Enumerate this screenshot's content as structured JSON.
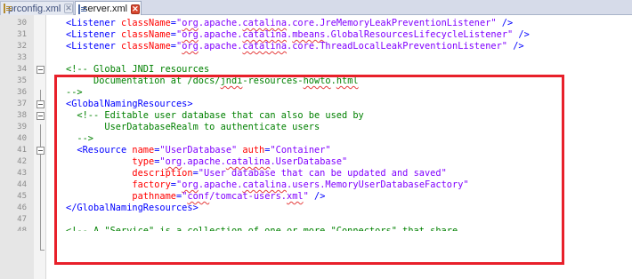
{
  "tabs": [
    {
      "label": "prconfig.xml",
      "close": "✕",
      "active": false
    },
    {
      "label": "server.xml",
      "close": "✕",
      "active": true
    }
  ],
  "editor": {
    "colors": {
      "tag": "#0000ff",
      "attr": "#ff0000",
      "value": "#8000ff",
      "comment": "#008000",
      "highlight": "#e8202a"
    },
    "lines": [
      {
        "n": "30",
        "tokens": [
          {
            "c": "t",
            "t": "<Listener "
          },
          {
            "c": "a",
            "t": "className"
          },
          {
            "c": "t",
            "t": "="
          },
          {
            "c": "v",
            "t": "\""
          },
          {
            "c": "vs",
            "t": "org"
          },
          {
            "c": "v",
            "t": ".apache."
          },
          {
            "c": "vs",
            "t": "catalina"
          },
          {
            "c": "v",
            "t": ".core.JreMemoryLeakPreventionListener\""
          },
          {
            "c": "t",
            "t": " />"
          }
        ]
      },
      {
        "n": "31",
        "tokens": [
          {
            "c": "t",
            "t": "<Listener "
          },
          {
            "c": "a",
            "t": "className"
          },
          {
            "c": "t",
            "t": "="
          },
          {
            "c": "v",
            "t": "\""
          },
          {
            "c": "vs",
            "t": "org"
          },
          {
            "c": "v",
            "t": ".apache."
          },
          {
            "c": "vs",
            "t": "catalina"
          },
          {
            "c": "v",
            "t": "."
          },
          {
            "c": "vs",
            "t": "mbeans"
          },
          {
            "c": "v",
            "t": ".GlobalResourcesLifecycleListener\""
          },
          {
            "c": "t",
            "t": " />"
          }
        ]
      },
      {
        "n": "32",
        "tokens": [
          {
            "c": "t",
            "t": "<Listener "
          },
          {
            "c": "a",
            "t": "className"
          },
          {
            "c": "t",
            "t": "="
          },
          {
            "c": "v",
            "t": "\""
          },
          {
            "c": "vs",
            "t": "org"
          },
          {
            "c": "v",
            "t": ".apache."
          },
          {
            "c": "vs",
            "t": "catalina"
          },
          {
            "c": "v",
            "t": ".core.ThreadLocalLeakPreventionListener\""
          },
          {
            "c": "t",
            "t": " />"
          }
        ]
      },
      {
        "n": "33",
        "tokens": []
      },
      {
        "n": "34",
        "fold": true,
        "tokens": [
          {
            "c": "c",
            "t": "<!-- Global JNDI resources"
          }
        ]
      },
      {
        "n": "35",
        "tokens": [
          {
            "c": "c",
            "t": "     Documentation at /docs/"
          },
          {
            "c": "cs",
            "t": "jndi"
          },
          {
            "c": "c",
            "t": "-resources-"
          },
          {
            "c": "cs",
            "t": "howto"
          },
          {
            "c": "c",
            "t": "."
          },
          {
            "c": "cs",
            "t": "html"
          }
        ]
      },
      {
        "n": "36",
        "tokens": [
          {
            "c": "c",
            "t": "-->"
          }
        ]
      },
      {
        "n": "37",
        "fold": true,
        "tokens": [
          {
            "c": "t",
            "t": "<GlobalNamingResources>"
          }
        ]
      },
      {
        "n": "38",
        "fold": true,
        "tokens": [
          {
            "c": "c",
            "t": "  <!-- Editable user database that can also be used by"
          }
        ]
      },
      {
        "n": "39",
        "tokens": [
          {
            "c": "c",
            "t": "       UserDatabaseRealm to authenticate users"
          }
        ]
      },
      {
        "n": "40",
        "tokens": [
          {
            "c": "c",
            "t": "  -->"
          }
        ]
      },
      {
        "n": "41",
        "fold": true,
        "tokens": [
          {
            "c": "t",
            "t": "  <Resource "
          },
          {
            "c": "a",
            "t": "name"
          },
          {
            "c": "t",
            "t": "="
          },
          {
            "c": "v",
            "t": "\"UserDatabase\""
          },
          {
            "c": "t",
            "t": " "
          },
          {
            "c": "a",
            "t": "auth"
          },
          {
            "c": "t",
            "t": "="
          },
          {
            "c": "v",
            "t": "\"Container\""
          }
        ]
      },
      {
        "n": "42",
        "tokens": [
          {
            "c": "a",
            "t": "            type"
          },
          {
            "c": "t",
            "t": "="
          },
          {
            "c": "v",
            "t": "\""
          },
          {
            "c": "vs",
            "t": "org"
          },
          {
            "c": "v",
            "t": ".apache."
          },
          {
            "c": "vs",
            "t": "catalina"
          },
          {
            "c": "v",
            "t": ".UserDatabase\""
          }
        ]
      },
      {
        "n": "43",
        "tokens": [
          {
            "c": "a",
            "t": "            description"
          },
          {
            "c": "t",
            "t": "="
          },
          {
            "c": "v",
            "t": "\"User database that can be updated and saved\""
          }
        ]
      },
      {
        "n": "44",
        "tokens": [
          {
            "c": "a",
            "t": "            factory"
          },
          {
            "c": "t",
            "t": "="
          },
          {
            "c": "v",
            "t": "\""
          },
          {
            "c": "vs",
            "t": "org"
          },
          {
            "c": "v",
            "t": ".apache."
          },
          {
            "c": "vs",
            "t": "catalina"
          },
          {
            "c": "v",
            "t": ".users.MemoryUserDatabaseFactory\""
          }
        ]
      },
      {
        "n": "45",
        "tokens": [
          {
            "c": "a",
            "t": "            pathname"
          },
          {
            "c": "t",
            "t": "="
          },
          {
            "c": "v",
            "t": "\""
          },
          {
            "c": "vs",
            "t": "conf"
          },
          {
            "c": "v",
            "t": "/tomcat-users."
          },
          {
            "c": "vs",
            "t": "xml"
          },
          {
            "c": "v",
            "t": "\""
          },
          {
            "c": "t",
            "t": " />"
          }
        ]
      },
      {
        "n": "46",
        "tokens": [
          {
            "c": "t",
            "t": "</GlobalNamingResources>"
          }
        ]
      },
      {
        "n": "47",
        "tokens": []
      },
      {
        "n": "48",
        "partial": true,
        "tokens": [
          {
            "c": "c",
            "t": "<!-- A \"Service\" is a collection of one or more \"Connectors\" that share"
          }
        ]
      }
    ]
  }
}
